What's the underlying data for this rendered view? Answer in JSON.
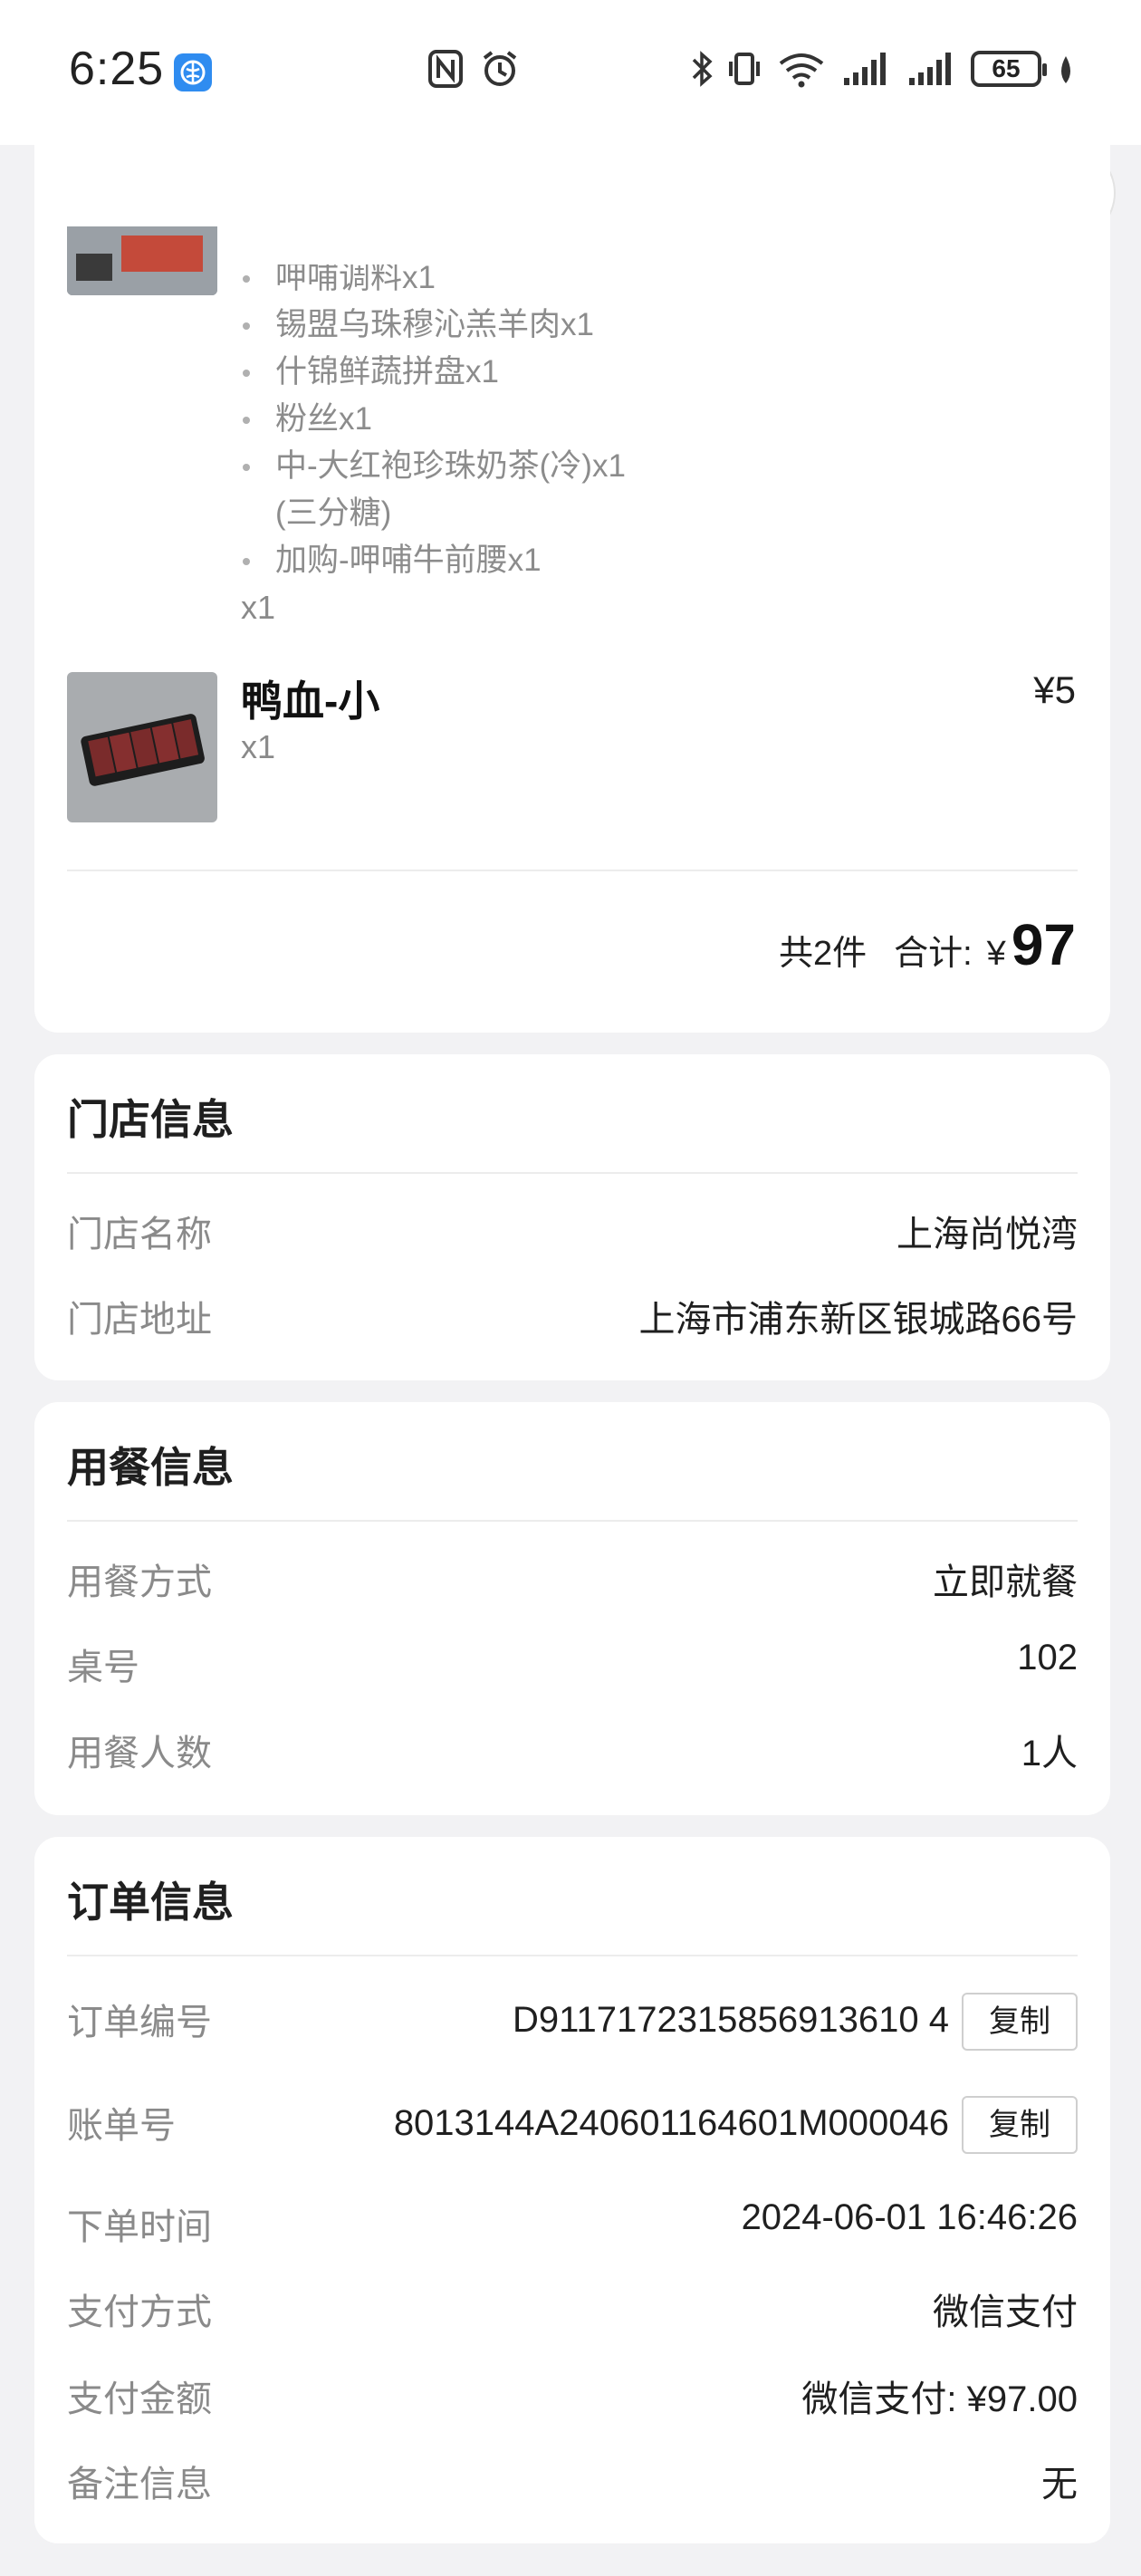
{
  "status_bar": {
    "time": "6:25",
    "battery": "65",
    "icons": [
      "browser-icon",
      "nfc-icon",
      "alarm-icon",
      "bluetooth-icon",
      "vibrate-icon",
      "wifi-icon",
      "signal-1-icon",
      "signal-2-icon",
      "leaf-icon"
    ]
  },
  "nav": {
    "icons": [
      "back-icon",
      "more-icon",
      "target-icon"
    ]
  },
  "order_items": {
    "first_item_sub_items": [
      "呷哺调料x1",
      "锡盟乌珠穆沁羔羊肉x1",
      "什锦鲜蔬拼盘x1",
      "粉丝x1",
      "中-大红袍珍珠奶茶(冷)x1",
      "(三分糖)",
      "加购-呷哺牛前腰x1"
    ],
    "first_item_qty": "x1",
    "second_item": {
      "name": "鸭血-小",
      "price": "¥5",
      "qty": "x1"
    },
    "total": {
      "count": "共2件",
      "label": "合计:",
      "currency": "¥",
      "amount": "97"
    }
  },
  "store_info": {
    "title": "门店信息",
    "rows": [
      {
        "key": "门店名称",
        "value": "上海尚悦湾"
      },
      {
        "key": "门店地址",
        "value": "上海市浦东新区银城路66号"
      }
    ]
  },
  "dining_info": {
    "title": "用餐信息",
    "rows": [
      {
        "key": "用餐方式",
        "value": "立即就餐"
      },
      {
        "key": "桌号",
        "value": "102"
      },
      {
        "key": "用餐人数",
        "value": "1人"
      }
    ]
  },
  "order_info": {
    "title": "订单信息",
    "copy_label": "复制",
    "rows": [
      {
        "key": "订单编号",
        "value": "D9117172315856913610 4"
      },
      {
        "key": "账单号",
        "value": "8013144A240601164601M000046"
      },
      {
        "key": "下单时间",
        "value": "2024-06-01 16:46:26"
      },
      {
        "key": "支付方式",
        "value": "微信支付"
      },
      {
        "key": "支付金额",
        "value": "微信支付: ¥97.00"
      },
      {
        "key": "备注信息",
        "value": "无"
      }
    ]
  },
  "colors": {
    "page_bg": "#f2f2f4",
    "card_bg": "#ffffff",
    "muted_text": "#8a8a8a"
  }
}
